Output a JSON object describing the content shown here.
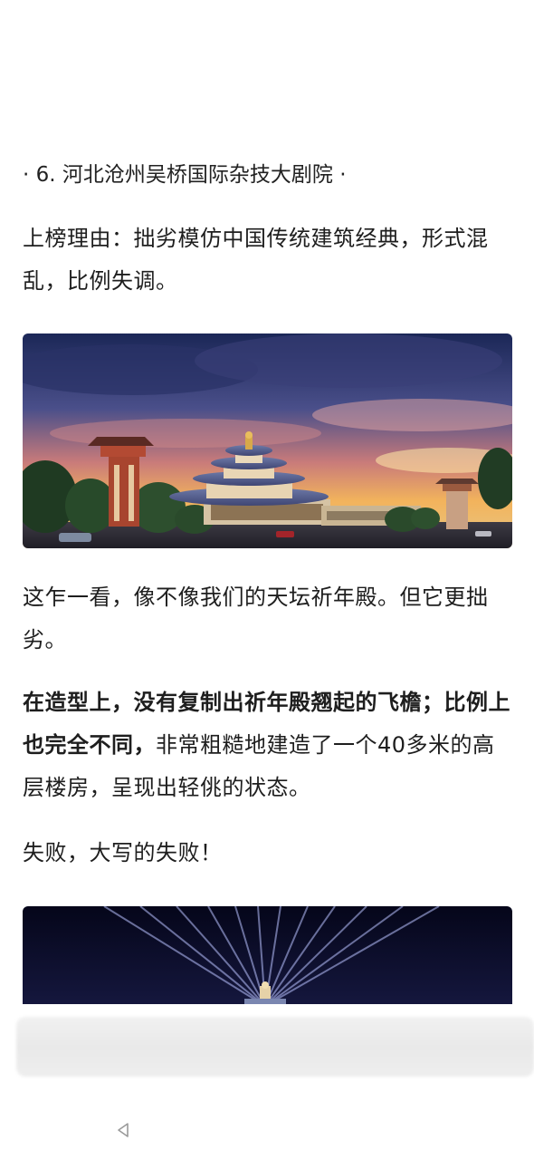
{
  "article": {
    "section_title": "· 6. 河北沧州吴桥国际杂技大剧院 ·",
    "reason": "上榜理由：拙劣模仿中国传统建筑经典，形式混乱，比例失调。",
    "para2": "这乍一看，像不像我们的天坛祈年殿。但它更拙劣。",
    "para3_bold": "在造型上，没有复制出祈年殿翘起的飞檐；比例上也完全不同，",
    "para3_rest": "非常粗糙地建造了一个40多米的高层楼房，呈现出轻佻的状态。",
    "para4": "失败，大写的失败！"
  },
  "nav": {
    "back_icon": "triangle-back-icon"
  },
  "colors": {
    "sky_top": "#1c2a5c",
    "sunset": "#f0a24a",
    "night": "#0b0d2a"
  }
}
